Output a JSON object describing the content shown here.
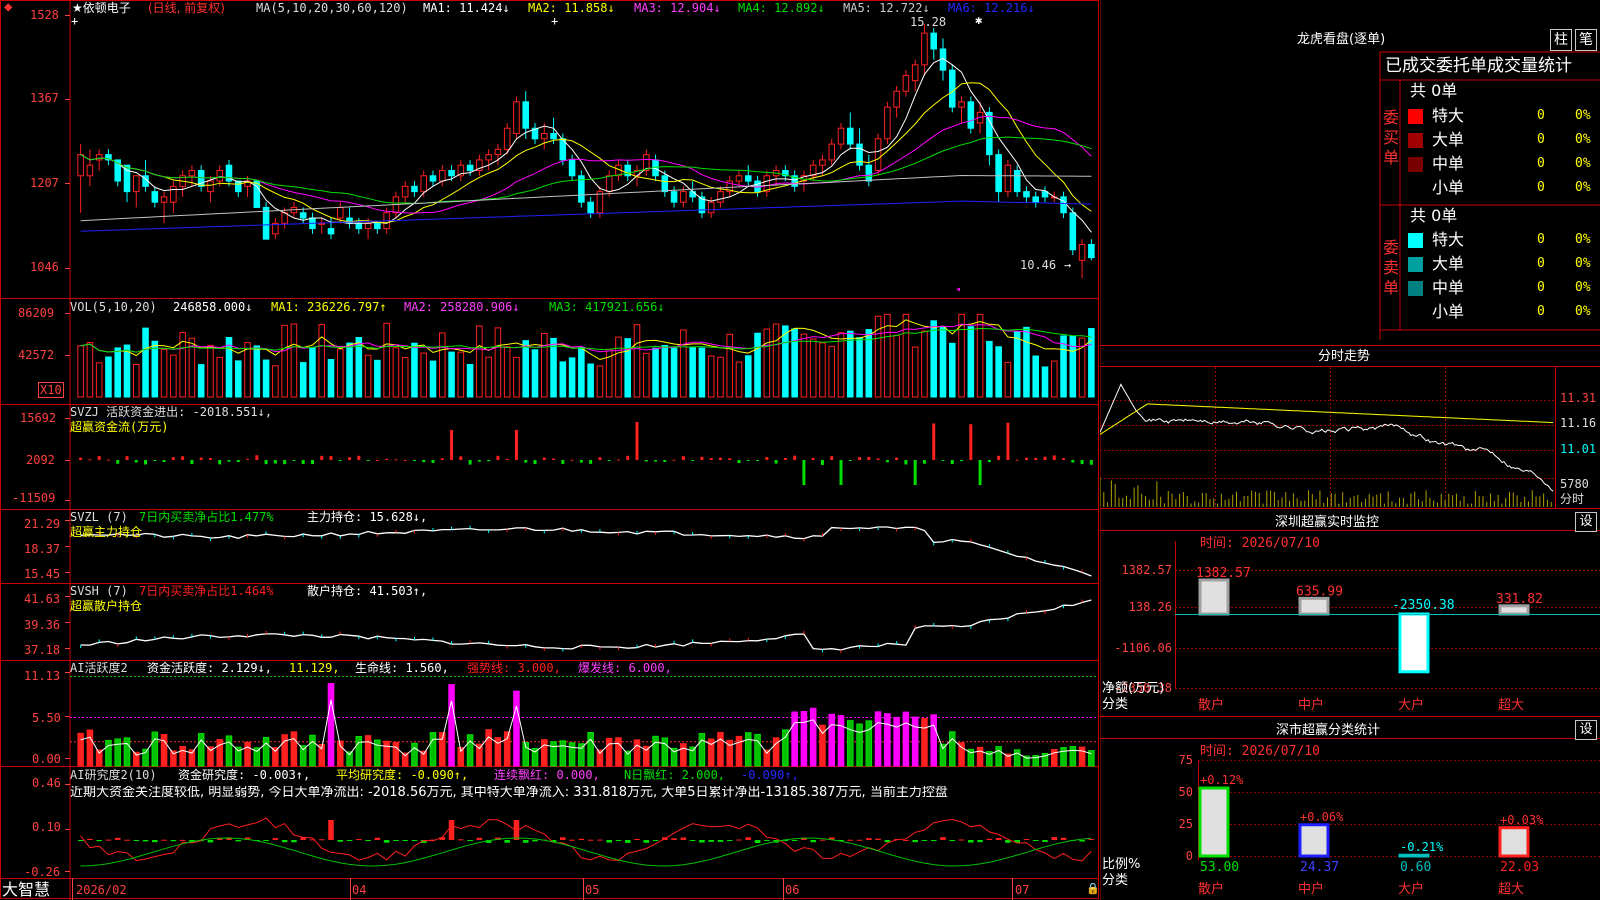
{
  "colors": {
    "up": "#ff2020",
    "down": "#00ffff",
    "border": "#c80000",
    "grid": "#7a0000",
    "axis": "#ff4040",
    "white": "#ffffff",
    "yellow": "#ffff00",
    "magenta": "#ff00ff",
    "green": "#00e000",
    "blue": "#2020ff"
  },
  "k": {
    "title": "★依顿电子",
    "mode": "(日线, 前复权)",
    "ma_text": "MA(5,10,20,30,60,120)",
    "ma1": "MA1: 11.424↓",
    "ma2": "MA2: 11.858↓",
    "ma3": "MA3: 12.904↓",
    "ma4": "MA4: 12.892↓",
    "ma5": "MA5: 12.722↓",
    "ma6": "MA6: 12.216↓",
    "yticks": [
      "1528",
      "1367",
      "1207",
      "1046"
    ],
    "yvals": [
      15.28,
      13.67,
      12.07,
      10.46
    ],
    "high_label": "15.28",
    "low_label": "10.46",
    "candles": [
      [
        12.4,
        13.0,
        11.7,
        12.8
      ],
      [
        12.4,
        12.9,
        12.2,
        12.6
      ],
      [
        12.7,
        12.9,
        12.5,
        12.8
      ],
      [
        12.8,
        12.9,
        12.6,
        12.7
      ],
      [
        12.7,
        12.7,
        12.2,
        12.3
      ],
      [
        12.6,
        12.6,
        11.9,
        12.1
      ],
      [
        12.1,
        12.4,
        11.8,
        12.4
      ],
      [
        12.4,
        12.7,
        12.1,
        12.2
      ],
      [
        12.1,
        12.2,
        11.8,
        11.9
      ],
      [
        11.9,
        12.1,
        11.5,
        12.0
      ],
      [
        11.9,
        12.3,
        11.7,
        12.2
      ],
      [
        12.2,
        12.5,
        12.0,
        12.4
      ],
      [
        12.4,
        12.6,
        12.2,
        12.5
      ],
      [
        12.5,
        12.6,
        12.1,
        12.2
      ],
      [
        12.1,
        12.4,
        11.9,
        12.3
      ],
      [
        12.3,
        12.6,
        12.2,
        12.5
      ],
      [
        12.6,
        12.7,
        12.2,
        12.3
      ],
      [
        12.3,
        12.3,
        12.0,
        12.1
      ],
      [
        12.2,
        12.4,
        12.0,
        12.3
      ],
      [
        12.3,
        12.3,
        11.8,
        11.8
      ],
      [
        11.8,
        11.9,
        11.2,
        11.2
      ],
      [
        11.3,
        11.6,
        11.2,
        11.5
      ],
      [
        11.5,
        11.8,
        11.4,
        11.7
      ],
      [
        11.7,
        11.9,
        11.6,
        11.8
      ],
      [
        11.7,
        11.8,
        11.5,
        11.6
      ],
      [
        11.6,
        11.7,
        11.3,
        11.4
      ],
      [
        11.5,
        11.6,
        11.3,
        11.5
      ],
      [
        11.4,
        11.6,
        11.2,
        11.3
      ],
      [
        11.6,
        11.9,
        11.5,
        11.8
      ],
      [
        11.6,
        11.8,
        11.4,
        11.5
      ],
      [
        11.5,
        11.6,
        11.3,
        11.4
      ],
      [
        11.4,
        11.6,
        11.2,
        11.5
      ],
      [
        11.5,
        11.5,
        11.3,
        11.4
      ],
      [
        11.4,
        11.8,
        11.3,
        11.7
      ],
      [
        11.7,
        12.1,
        11.6,
        12.0
      ],
      [
        12.0,
        12.3,
        11.9,
        12.2
      ],
      [
        12.2,
        12.3,
        12.0,
        12.1
      ],
      [
        12.1,
        12.5,
        12.0,
        12.4
      ],
      [
        12.4,
        12.5,
        12.2,
        12.3
      ],
      [
        12.3,
        12.6,
        12.2,
        12.5
      ],
      [
        12.5,
        12.6,
        12.3,
        12.4
      ],
      [
        12.4,
        12.7,
        12.3,
        12.6
      ],
      [
        12.6,
        12.7,
        12.4,
        12.5
      ],
      [
        12.5,
        12.8,
        12.4,
        12.7
      ],
      [
        12.7,
        12.9,
        12.5,
        12.8
      ],
      [
        12.8,
        13.0,
        12.6,
        12.9
      ],
      [
        12.9,
        13.4,
        12.8,
        13.3
      ],
      [
        13.2,
        13.9,
        13.1,
        13.8
      ],
      [
        13.8,
        14.0,
        13.1,
        13.3
      ],
      [
        13.3,
        13.4,
        13.0,
        13.1
      ],
      [
        13.1,
        13.4,
        12.9,
        13.2
      ],
      [
        13.2,
        13.5,
        13.0,
        13.1
      ],
      [
        13.1,
        13.2,
        12.6,
        12.7
      ],
      [
        12.7,
        12.8,
        12.3,
        12.4
      ],
      [
        12.4,
        12.5,
        11.8,
        11.9
      ],
      [
        11.9,
        12.0,
        11.6,
        11.7
      ],
      [
        11.7,
        12.2,
        11.6,
        12.1
      ],
      [
        12.1,
        12.5,
        12.0,
        12.4
      ],
      [
        12.4,
        12.7,
        12.3,
        12.6
      ],
      [
        12.6,
        12.7,
        12.3,
        12.4
      ],
      [
        12.4,
        12.6,
        12.2,
        12.5
      ],
      [
        12.5,
        12.9,
        12.4,
        12.8
      ],
      [
        12.7,
        12.8,
        12.3,
        12.4
      ],
      [
        12.4,
        12.5,
        12.0,
        12.1
      ],
      [
        12.1,
        12.2,
        11.8,
        11.9
      ],
      [
        11.9,
        12.2,
        11.8,
        12.1
      ],
      [
        12.1,
        12.3,
        11.9,
        12.0
      ],
      [
        12.0,
        12.1,
        11.6,
        11.7
      ],
      [
        11.7,
        12.0,
        11.6,
        11.9
      ],
      [
        11.9,
        12.2,
        11.8,
        12.1
      ],
      [
        12.1,
        12.4,
        12.0,
        12.3
      ],
      [
        12.3,
        12.5,
        12.2,
        12.4
      ],
      [
        12.4,
        12.6,
        12.2,
        12.3
      ],
      [
        12.3,
        12.4,
        12.0,
        12.1
      ],
      [
        12.1,
        12.5,
        12.0,
        12.4
      ],
      [
        12.4,
        12.6,
        12.2,
        12.5
      ],
      [
        12.5,
        12.6,
        12.3,
        12.4
      ],
      [
        12.4,
        12.5,
        12.1,
        12.2
      ],
      [
        12.3,
        12.5,
        12.1,
        12.4
      ],
      [
        12.4,
        12.7,
        12.3,
        12.6
      ],
      [
        12.6,
        12.8,
        12.4,
        12.7
      ],
      [
        12.7,
        13.1,
        12.6,
        13.0
      ],
      [
        13.0,
        13.4,
        12.9,
        13.3
      ],
      [
        13.3,
        13.6,
        12.9,
        13.0
      ],
      [
        13.0,
        13.3,
        12.5,
        12.6
      ],
      [
        12.6,
        12.8,
        12.2,
        12.3
      ],
      [
        12.5,
        13.2,
        12.4,
        13.1
      ],
      [
        13.1,
        13.8,
        13.0,
        13.7
      ],
      [
        13.7,
        14.1,
        13.5,
        14.0
      ],
      [
        14.0,
        14.4,
        13.9,
        14.3
      ],
      [
        14.2,
        14.6,
        14.0,
        14.5
      ],
      [
        14.5,
        15.28,
        14.3,
        15.1
      ],
      [
        15.1,
        15.2,
        14.6,
        14.8
      ],
      [
        14.8,
        15.0,
        14.2,
        14.4
      ],
      [
        14.4,
        14.5,
        13.6,
        13.7
      ],
      [
        13.7,
        13.9,
        13.4,
        13.8
      ],
      [
        13.8,
        13.9,
        13.2,
        13.3
      ],
      [
        13.4,
        13.8,
        13.2,
        13.6
      ],
      [
        13.6,
        13.7,
        12.6,
        12.8
      ],
      [
        12.8,
        12.9,
        11.9,
        12.1
      ],
      [
        12.1,
        12.7,
        12.0,
        12.6
      ],
      [
        12.5,
        12.6,
        12.0,
        12.1
      ],
      [
        12.1,
        12.2,
        11.9,
        12.0
      ],
      [
        12.0,
        12.1,
        11.8,
        11.9
      ],
      [
        12.1,
        12.2,
        11.9,
        12.0
      ],
      [
        12.0,
        12.1,
        11.9,
        12.0
      ],
      [
        12.0,
        12.1,
        11.6,
        11.7
      ],
      [
        11.7,
        11.8,
        10.9,
        11.0
      ],
      [
        10.8,
        11.2,
        10.46,
        11.1
      ],
      [
        11.1,
        11.2,
        10.8,
        10.85
      ]
    ]
  },
  "vol": {
    "label": "VOL(5,10,20)",
    "v": "246858.000↓",
    "ma1": "MA1: 236226.797↑",
    "ma2": "MA2: 258280.906↓",
    "ma3": "MA3: 417921.656↓",
    "yticks": [
      "86209",
      "42572"
    ],
    "x10": "X10"
  },
  "svzj": {
    "label": "SVZJ 活跃资金进出: -2018.551↓,",
    "sub": "超赢资金流(万元)",
    "yticks": [
      "15692",
      "2092",
      "-11509"
    ]
  },
  "svzl": {
    "label": "SVZL (7)",
    "ratio": "7日内买卖净占比1.477%",
    "hold": "主力持仓: 15.628↓,",
    "sub": "超赢主力持仓",
    "yticks": [
      "21.29",
      "18.37",
      "15.45"
    ]
  },
  "svsh": {
    "label": "SVSH (7)",
    "ratio": "7日内买卖净占比1.464%",
    "hold": "散户持仓: 41.503↑,",
    "sub": "超赢散户持仓",
    "yticks": [
      "41.63",
      "39.36",
      "37.18"
    ]
  },
  "ai1": {
    "label": "AI活跃度2",
    "a": "资金活跃度: 2.129↓,",
    "b": "11.129,",
    "c": "生命线: 1.560,",
    "d": "强势线: 3.000,",
    "e": "爆发线: 6.000,",
    "yticks": [
      "11.13",
      "5.50",
      "0.00"
    ]
  },
  "ai2": {
    "label": "AI研究度2(10)",
    "a": "资金研究度: -0.003↑,",
    "b": "平均研究度: -0.090↑,",
    "c": "连续飘红: 0.000,",
    "d": "N日飘红: 2.000,",
    "e": "-0.090↑,",
    "comment": "近期大资金关注度较低, 明显弱势, 今日大单净流出: -2018.56万元, 其中特大单净流入: 331.818万元, 大单5日累计净出-13185.387万元, 当前主力控盘",
    "yticks": [
      "0.46",
      "0.10",
      "-0.26"
    ]
  },
  "xaxis": {
    "app": "大智慧",
    "labels": [
      "2026/02",
      "04",
      "05",
      "06",
      "07"
    ]
  },
  "side": {
    "lhb_title": "龙虎看盘(逐单)",
    "btn1": "柱",
    "btn2": "笔",
    "stat_title": "已成交委托单成交量统计",
    "buy_label": "委买单",
    "sell_label": "委卖单",
    "buy_total": "共 0单",
    "sell_total": "共 0单",
    "buy_rows": [
      {
        "name": "特大",
        "v": "0",
        "p": "0%",
        "color": "#ff0000"
      },
      {
        "name": "大单",
        "v": "0",
        "p": "0%",
        "color": "#a00000"
      },
      {
        "name": "中单",
        "v": "0",
        "p": "0%",
        "color": "#780000"
      },
      {
        "name": "小单",
        "v": "0",
        "p": "0%",
        "color": ""
      }
    ],
    "sell_rows": [
      {
        "name": "特大",
        "v": "0",
        "p": "0%",
        "color": "#00ffff"
      },
      {
        "name": "大单",
        "v": "0",
        "p": "0%",
        "color": "#00a0a0"
      },
      {
        "name": "中单",
        "v": "0",
        "p": "0%",
        "color": "#008080"
      },
      {
        "name": "小单",
        "v": "0",
        "p": "0%",
        "color": ""
      }
    ],
    "fs_title": "分时走势",
    "fs_ticks": [
      "11.31",
      "11.16",
      "11.01"
    ],
    "fs_vol": "5780",
    "fs_vol_label": "分时",
    "mon_title": "深圳超赢实时监控",
    "mon_btn": "设",
    "mon_time": "时间: 2026/07/10",
    "mon_yticks": [
      "1382.57",
      "138.26",
      "-1106.06",
      "-2350.38"
    ],
    "mon_unit": "净额(万元)",
    "mon_cat": "分类",
    "mon_bars": [
      {
        "name": "散户",
        "value": 1382.57,
        "label": "1382.57"
      },
      {
        "name": "中户",
        "value": 635.99,
        "label": "635.99"
      },
      {
        "name": "大户",
        "value": -2350.38,
        "label": "-2350.38"
      },
      {
        "name": "超大",
        "value": 331.82,
        "label": "331.82"
      }
    ],
    "cls_title": "深市超赢分类统计",
    "cls_btn": "设",
    "cls_time": "时间: 2026/07/10",
    "cls_yticks": [
      "75",
      "50",
      "25",
      "0"
    ],
    "cls_unit": "比例%",
    "cls_cat": "分类",
    "cls_bars": [
      {
        "name": "散户",
        "value": 53.0,
        "label": "53.00",
        "chg": "+0.12%"
      },
      {
        "name": "中户",
        "value": 24.37,
        "label": "24.37",
        "chg": "+0.06%"
      },
      {
        "name": "大户",
        "value": 0.6,
        "label": "0.60",
        "chg": "-0.21%"
      },
      {
        "name": "超大",
        "value": 22.03,
        "label": "22.03",
        "chg": "+0.03%"
      }
    ]
  }
}
